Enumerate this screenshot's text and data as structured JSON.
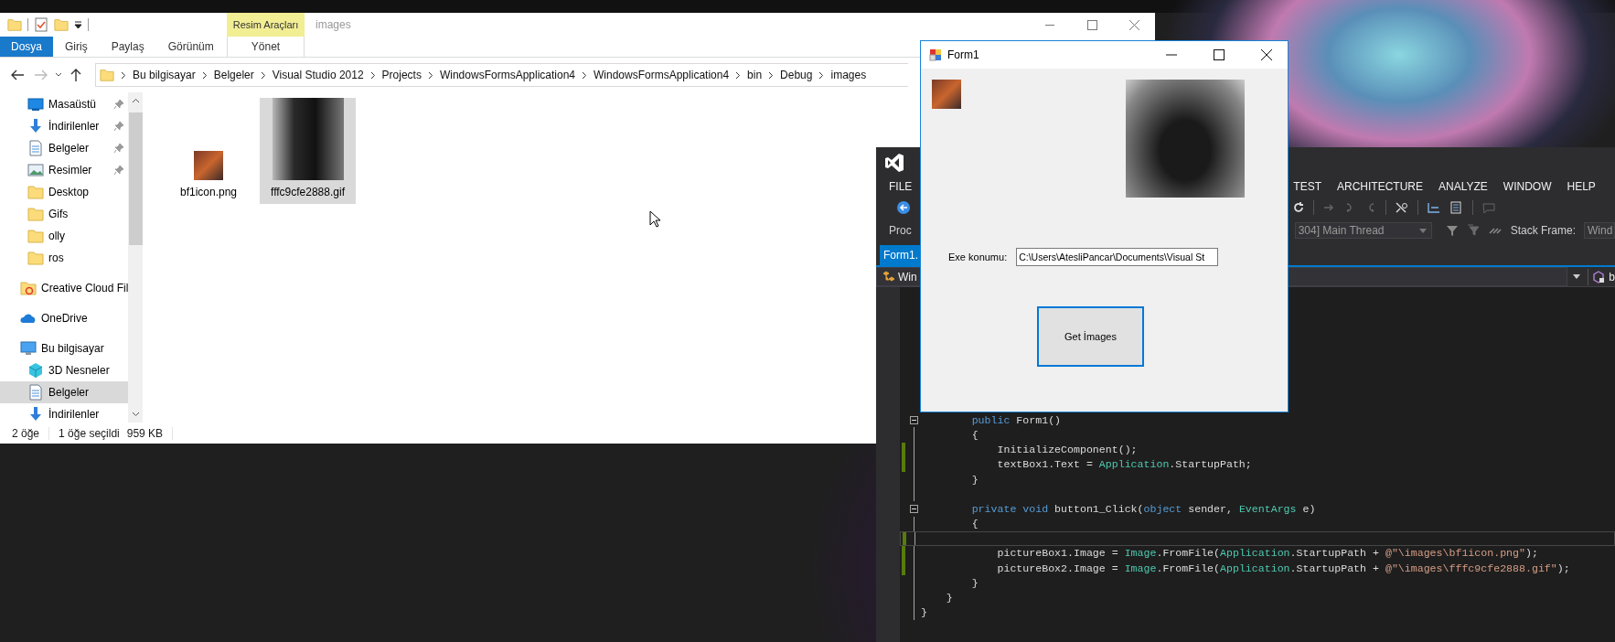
{
  "explorer": {
    "title": "images",
    "tool_group": "Resim Araçları",
    "ribbon_tabs": [
      {
        "label": "Dosya",
        "kind": "file",
        "selected": false
      },
      {
        "label": "Giriş",
        "kind": "tab",
        "selected": false
      },
      {
        "label": "Paylaş",
        "kind": "tab",
        "selected": false
      },
      {
        "label": "Görünüm",
        "kind": "tab",
        "selected": false
      },
      {
        "label": "Yönet",
        "kind": "tool",
        "selected": false
      }
    ],
    "breadcrumb": [
      "Bu bilgisayar",
      "Belgeler",
      "Visual Studio 2012",
      "Projects",
      "WindowsFormsApplication4",
      "WindowsFormsApplication4",
      "bin",
      "Debug",
      "images"
    ],
    "quick_access": [
      {
        "label": "Masaüstü",
        "kind": "desktop",
        "pinned": true,
        "selected": false
      },
      {
        "label": "İndirilenler",
        "kind": "download",
        "pinned": true,
        "selected": false
      },
      {
        "label": "Belgeler",
        "kind": "document",
        "pinned": true,
        "selected": false
      },
      {
        "label": "Resimler",
        "kind": "picture",
        "pinned": true,
        "selected": false
      },
      {
        "label": "Desktop",
        "kind": "folder",
        "pinned": false,
        "selected": false
      },
      {
        "label": "Gifs",
        "kind": "folder",
        "pinned": false,
        "selected": false
      },
      {
        "label": "olly",
        "kind": "folder",
        "pinned": false,
        "selected": false
      },
      {
        "label": "ros",
        "kind": "folder",
        "pinned": false,
        "selected": false
      }
    ],
    "sidebar": [
      {
        "label": "Creative Cloud Fil",
        "kind": "cloud-folder",
        "selected": false
      },
      {
        "label": "OneDrive",
        "kind": "cloud",
        "selected": false
      },
      {
        "label": "Bu bilgisayar",
        "kind": "computer",
        "selected": false,
        "children": [
          {
            "label": "3D Nesneler",
            "kind": "cube",
            "selected": false
          },
          {
            "label": "Belgeler",
            "kind": "document",
            "selected": true
          },
          {
            "label": "İndirilenler",
            "kind": "download",
            "selected": false
          }
        ]
      }
    ],
    "files": [
      {
        "name": "bf1icon.png",
        "selected": false
      },
      {
        "name": "fffc9cfe2888.gif",
        "selected": true
      }
    ],
    "status": {
      "count": "2 öğe",
      "selection": "1 öğe seçildi",
      "size": "959 KB"
    }
  },
  "form": {
    "title": "Form1",
    "label": "Exe konumu:",
    "path": "C:\\Users\\AtesliPancar\\Documents\\Visual St",
    "button": "Get İmages"
  },
  "visual_studio": {
    "menu": [
      "FILE",
      "TEST",
      "ARCHITECTURE",
      "ANALYZE",
      "WINDOW",
      "HELP"
    ],
    "process_label": "Proc",
    "thread": "304] Main Thread",
    "stack_frame_label": "Stack Frame:",
    "stack_frame_value": "Wind",
    "document_tab": "Form1.",
    "type_dropdown": "Win",
    "member_dropdown": "b",
    "code": [
      {
        "tokens": [
          {
            "text": "        public",
            "kind": "keyword"
          },
          {
            "text": " Form1()",
            "kind": "plain"
          }
        ],
        "changed": false,
        "fold": true,
        "current": false
      },
      {
        "tokens": [
          {
            "text": "        {",
            "kind": "plain"
          }
        ],
        "changed": false,
        "fold": false,
        "current": false
      },
      {
        "tokens": [
          {
            "text": "            InitializeComponent();",
            "kind": "plain"
          }
        ],
        "changed": true,
        "fold": false,
        "current": false
      },
      {
        "tokens": [
          {
            "text": "            textBox1.Text = ",
            "kind": "plain"
          },
          {
            "text": "Application",
            "kind": "type"
          },
          {
            "text": ".StartupPath;",
            "kind": "plain"
          }
        ],
        "changed": true,
        "fold": false,
        "current": false
      },
      {
        "tokens": [
          {
            "text": "        }",
            "kind": "plain"
          }
        ],
        "changed": false,
        "fold": false,
        "current": false
      },
      {
        "changed": false,
        "fold": false,
        "current": false
      },
      {
        "tokens": [
          {
            "text": "        private void",
            "kind": "keyword"
          },
          {
            "text": " button1_Click(",
            "kind": "plain"
          },
          {
            "text": "object",
            "kind": "keyword"
          },
          {
            "text": " sender, ",
            "kind": "plain"
          },
          {
            "text": "EventArgs",
            "kind": "type"
          },
          {
            "text": " e)",
            "kind": "plain"
          }
        ],
        "changed": false,
        "fold": true,
        "current": false
      },
      {
        "tokens": [
          {
            "text": "        {",
            "kind": "plain"
          }
        ],
        "changed": false,
        "fold": false,
        "current": false
      },
      {
        "changed": true,
        "fold": false,
        "current": true
      },
      {
        "tokens": [
          {
            "text": "            pictureBox1.Image = ",
            "kind": "plain"
          },
          {
            "text": "Image",
            "kind": "type"
          },
          {
            "text": ".FromFile(",
            "kind": "plain"
          },
          {
            "text": "Application",
            "kind": "type"
          },
          {
            "text": ".StartupPath + ",
            "kind": "plain"
          },
          {
            "text": "@\"\\images\\bf1icon.png\"",
            "kind": "string"
          },
          {
            "text": ");",
            "kind": "plain"
          }
        ],
        "changed": true,
        "fold": false,
        "current": false
      },
      {
        "tokens": [
          {
            "text": "            pictureBox2.Image = ",
            "kind": "plain"
          },
          {
            "text": "Image",
            "kind": "type"
          },
          {
            "text": ".FromFile(",
            "kind": "plain"
          },
          {
            "text": "Application",
            "kind": "type"
          },
          {
            "text": ".StartupPath + ",
            "kind": "plain"
          },
          {
            "text": "@\"\\images\\fffc9cfe2888.gif\"",
            "kind": "string"
          },
          {
            "text": ");",
            "kind": "plain"
          }
        ],
        "changed": true,
        "fold": false,
        "current": false
      },
      {
        "tokens": [
          {
            "text": "        }",
            "kind": "plain"
          }
        ],
        "changed": false,
        "fold": false,
        "current": false
      },
      {
        "tokens": [
          {
            "text": "    }",
            "kind": "plain"
          }
        ],
        "changed": false,
        "fold": false,
        "current": false
      },
      {
        "tokens": [
          {
            "text": "}",
            "kind": "plain"
          }
        ],
        "changed": false,
        "fold": false,
        "current": false
      }
    ]
  }
}
